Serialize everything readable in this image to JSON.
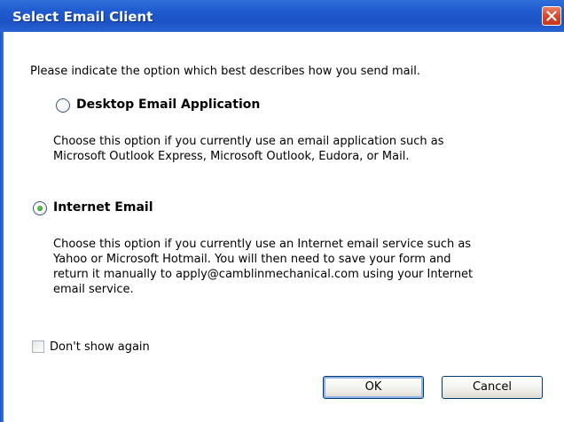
{
  "dialog": {
    "title": "Select Email Client",
    "instruction": "Please indicate the option which best describes how you send mail.",
    "options": [
      {
        "label": "Desktop Email Application",
        "selected": false,
        "description_lines": [
          "Choose this option if you currently use an email application such as",
          "Microsoft Outlook Express, Microsoft Outlook, Eudora, or Mail."
        ]
      },
      {
        "label": "Internet Email",
        "selected": true,
        "description_lines": [
          "Choose this option if you currently use an Internet email service such as",
          "Yahoo or Microsoft Hotmail. You will then need to save your form and",
          "return it manually to apply@camblinmechanical.com using your Internet",
          "email service."
        ]
      }
    ],
    "dont_show_again_label": "Don't show again",
    "dont_show_again_checked": false,
    "ok_label": "OK",
    "cancel_label": "Cancel"
  },
  "colors": {
    "titlebar": "#1f5bd0",
    "close_button": "#d9472b",
    "radio_dot": "#2f9a1f",
    "button_border": "#003c74"
  },
  "icons": {
    "close": "close-icon"
  }
}
